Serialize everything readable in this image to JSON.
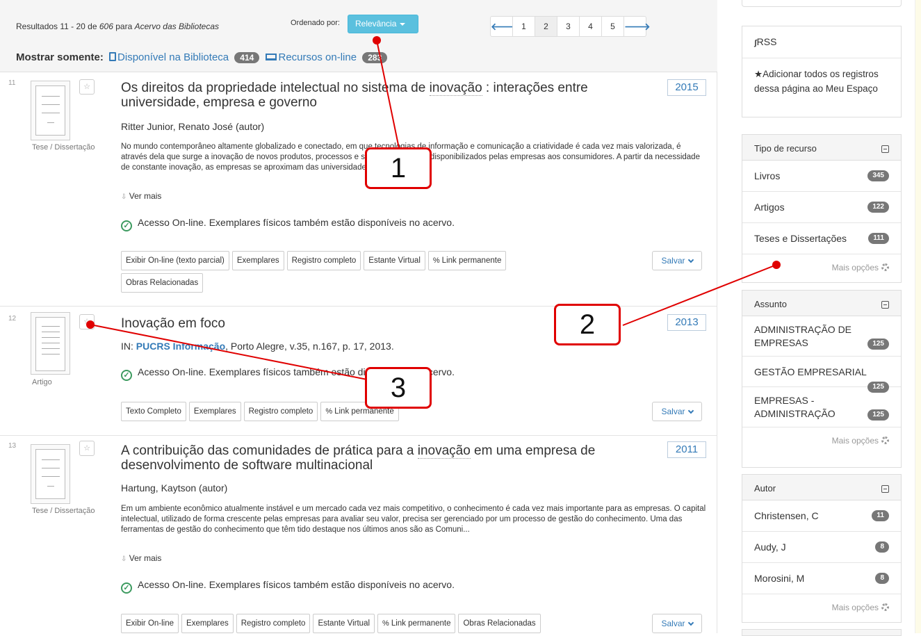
{
  "header": {
    "results_prefix": "Resultados 11 - 20 de",
    "results_total": "606",
    "results_for": "para",
    "results_collection": "Acervo das Bibliotecas",
    "sort_label": "Ordenado por:",
    "sort_value": "Relevância",
    "pages": [
      "1",
      "2",
      "3",
      "4",
      "5"
    ],
    "active_page": "2",
    "prev_icon": "arrow-left-icon",
    "next_icon": "arrow-right-icon",
    "show_only_label": "Mostrar somente:",
    "filter_library": "Disponível na Biblioteca",
    "filter_library_count": "414",
    "filter_online": "Recursos on-line",
    "filter_online_count": "283"
  },
  "records": [
    {
      "num": "11",
      "type": "Tese / Dissertação",
      "title_pre": "Os direitos da propriedade intelectual no sistema de ",
      "title_hl": "inovação",
      "title_post": " : interações entre universidade, empresa e governo",
      "year": "2015",
      "author": "Ritter Junior, Renato José (autor)",
      "abstract": "No mundo contemporâneo altamente globalizado e conectado, em que tecnologias de informação e comunicação a criatividade é cada vez mais valorizada, é através dela que surge a inovação de novos produtos, processos e serviços que serão disponibilizados pelas empresas aos consumidores. A partir da necessidade de constante inovação, as empresas se aproximam das universidades em busca de c...",
      "more": "Ver mais",
      "online": "Acesso On-line. Exemplares físicos também estão disponíveis no acervo.",
      "buttons": [
        "Exibir On-line (texto parcial)",
        "Exemplares",
        "Registro completo",
        "Estante Virtual",
        "Link permanente",
        "Obras Relacionadas"
      ],
      "save": "Salvar"
    },
    {
      "num": "12",
      "type": "Artigo",
      "title": "Inovação em foco",
      "year": "2013",
      "in_label": "IN:",
      "in_source": "PUCRS Informação",
      "in_rest": ", Porto Alegre, v.35, n.167, p. 17, 2013.",
      "online": "Acesso On-line. Exemplares físicos também estão disponíveis no acervo.",
      "buttons": [
        "Texto Completo",
        "Exemplares",
        "Registro completo",
        "Link permanente"
      ],
      "save": "Salvar"
    },
    {
      "num": "13",
      "type": "Tese / Dissertação",
      "title_pre": "A contribuição das comunidades de prática para a ",
      "title_hl": "inovação",
      "title_post": " em uma empresa de desenvolvimento de software multinacional",
      "year": "2011",
      "author": "Hartung, Kaytson (autor)",
      "abstract": "Em um ambiente econômico atualmente instável e um mercado cada vez mais competitivo, o conhecimento é cada vez mais importante para as empresas. O capital intelectual, utilizado de forma crescente pelas empresas para avaliar seu valor, precisa ser gerenciado por um processo de gestão do conhecimento. Uma das ferramentas de gestão do conhecimento que têm tido destaque nos últimos anos são as Comuni...",
      "more": "Ver mais",
      "online": "Acesso On-line. Exemplares físicos também estão disponíveis no acervo.",
      "buttons": [
        "Exibir On-line",
        "Exemplares",
        "Registro completo",
        "Estante Virtual",
        "Link permanente",
        "Obras Relacionadas"
      ],
      "save": "Salvar"
    }
  ],
  "sidebar": {
    "rss": "RSS",
    "add_all": "Adicionar todos os registros dessa página ao Meu Espaço",
    "more_options": "Mais opções",
    "facets": [
      {
        "title": "Tipo de recurso",
        "items": [
          {
            "label": "Livros",
            "count": "345"
          },
          {
            "label": "Artigos",
            "count": "122"
          },
          {
            "label": "Teses e Dissertações",
            "count": "111"
          }
        ]
      },
      {
        "title": "Assunto",
        "items": [
          {
            "label": "ADMINISTRAÇÃO DE EMPRESAS",
            "count": "125"
          },
          {
            "label": "GESTÃO EMPRESARIAL",
            "count": "125"
          },
          {
            "label": "EMPRESAS - ADMINISTRAÇÃO",
            "count": "125"
          }
        ]
      },
      {
        "title": "Autor",
        "items": [
          {
            "label": "Christensen, C",
            "count": "11"
          },
          {
            "label": "Audy, J",
            "count": "8"
          },
          {
            "label": "Morosini, M",
            "count": "8"
          }
        ]
      }
    ]
  },
  "annotations": {
    "callouts": [
      "1",
      "2",
      "3"
    ],
    "color": "#e00000"
  },
  "colors": {
    "accent": "#337ab7",
    "sort_button": "#5bc0de",
    "badge": "#777777",
    "online_check": "#3c9a5f"
  }
}
